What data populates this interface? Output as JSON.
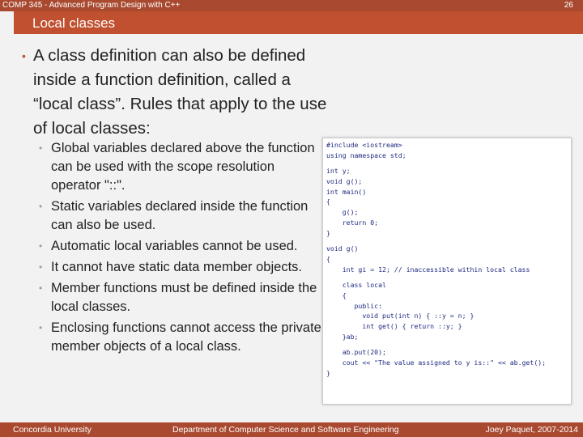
{
  "header": {
    "course": "COMP 345 - Advanced Program Design with C++",
    "page_number": "26"
  },
  "slide": {
    "title": "Local classes",
    "main_bullet": "A class definition can also be defined inside a function definition, called a “local class”. Rules that apply to the use of local classes:",
    "sub_bullets": [
      "Global variables declared above the function can be used with the scope resolution operator \"::\".",
      "Static variables declared inside the function can also be used.",
      "Automatic local variables cannot be used.",
      "It cannot have static data member objects.",
      "Member functions must be defined inside the local classes.",
      "Enclosing functions cannot access the private member objects of a local class."
    ]
  },
  "code_lines": [
    "#include <iostream>",
    "using namespace std;",
    "",
    "int y;",
    "void g();",
    "int main()",
    "{",
    "    g();",
    "    return 0;",
    "}",
    "",
    "void g()",
    "{",
    "    int gi = 12; // inaccessible within local class",
    "",
    "    class local",
    "    {",
    "       public:",
    "         void put(int n) { ::y = n; }",
    "         int get() { return ::y; }",
    "    }ab;",
    "",
    "    ab.put(20);",
    "    cout << \"The value assigned to y is::\" << ab.get();",
    "}"
  ],
  "footer": {
    "left": "Concordia University",
    "center": "Department of Computer Science and Software Engineering",
    "right": "Joey Paquet, 2007-2014"
  }
}
